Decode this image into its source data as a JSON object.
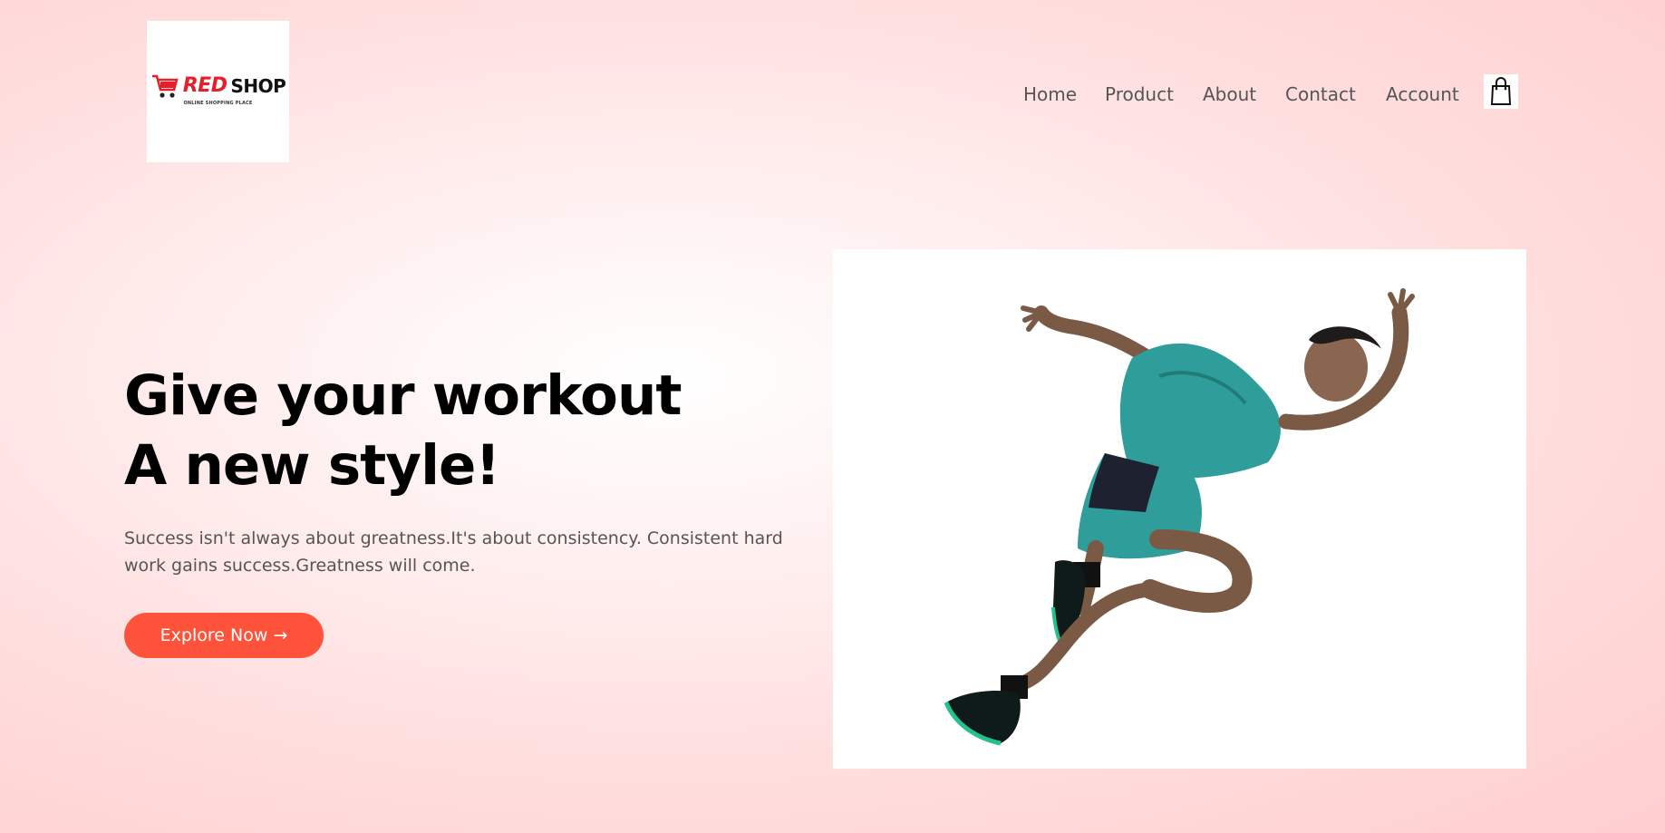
{
  "logo": {
    "brand_red": "RED",
    "brand_black": "SHOP",
    "tagline": "ONLINE SHOPPING PLACE",
    "icon": "shopping-cart-icon"
  },
  "nav": {
    "items": [
      {
        "label": "Home"
      },
      {
        "label": "Product"
      },
      {
        "label": "About"
      },
      {
        "label": "Contact"
      },
      {
        "label": "Account"
      }
    ],
    "cart_icon": "shopping-bag-icon"
  },
  "hero": {
    "title_line1": "Give your workout",
    "title_line2": "A new style!",
    "text": "Success isn't always about greatness.It's about consistency. Consistent hard work gains success.Greatness will come.",
    "cta_label": "Explore Now →",
    "image_subject": "sprinting-athlete-image"
  },
  "colors": {
    "accent": "#ff523b",
    "brand_red": "#e5202a",
    "background": "#ffdede",
    "text_dark": "#000000",
    "text_muted": "#555555"
  }
}
